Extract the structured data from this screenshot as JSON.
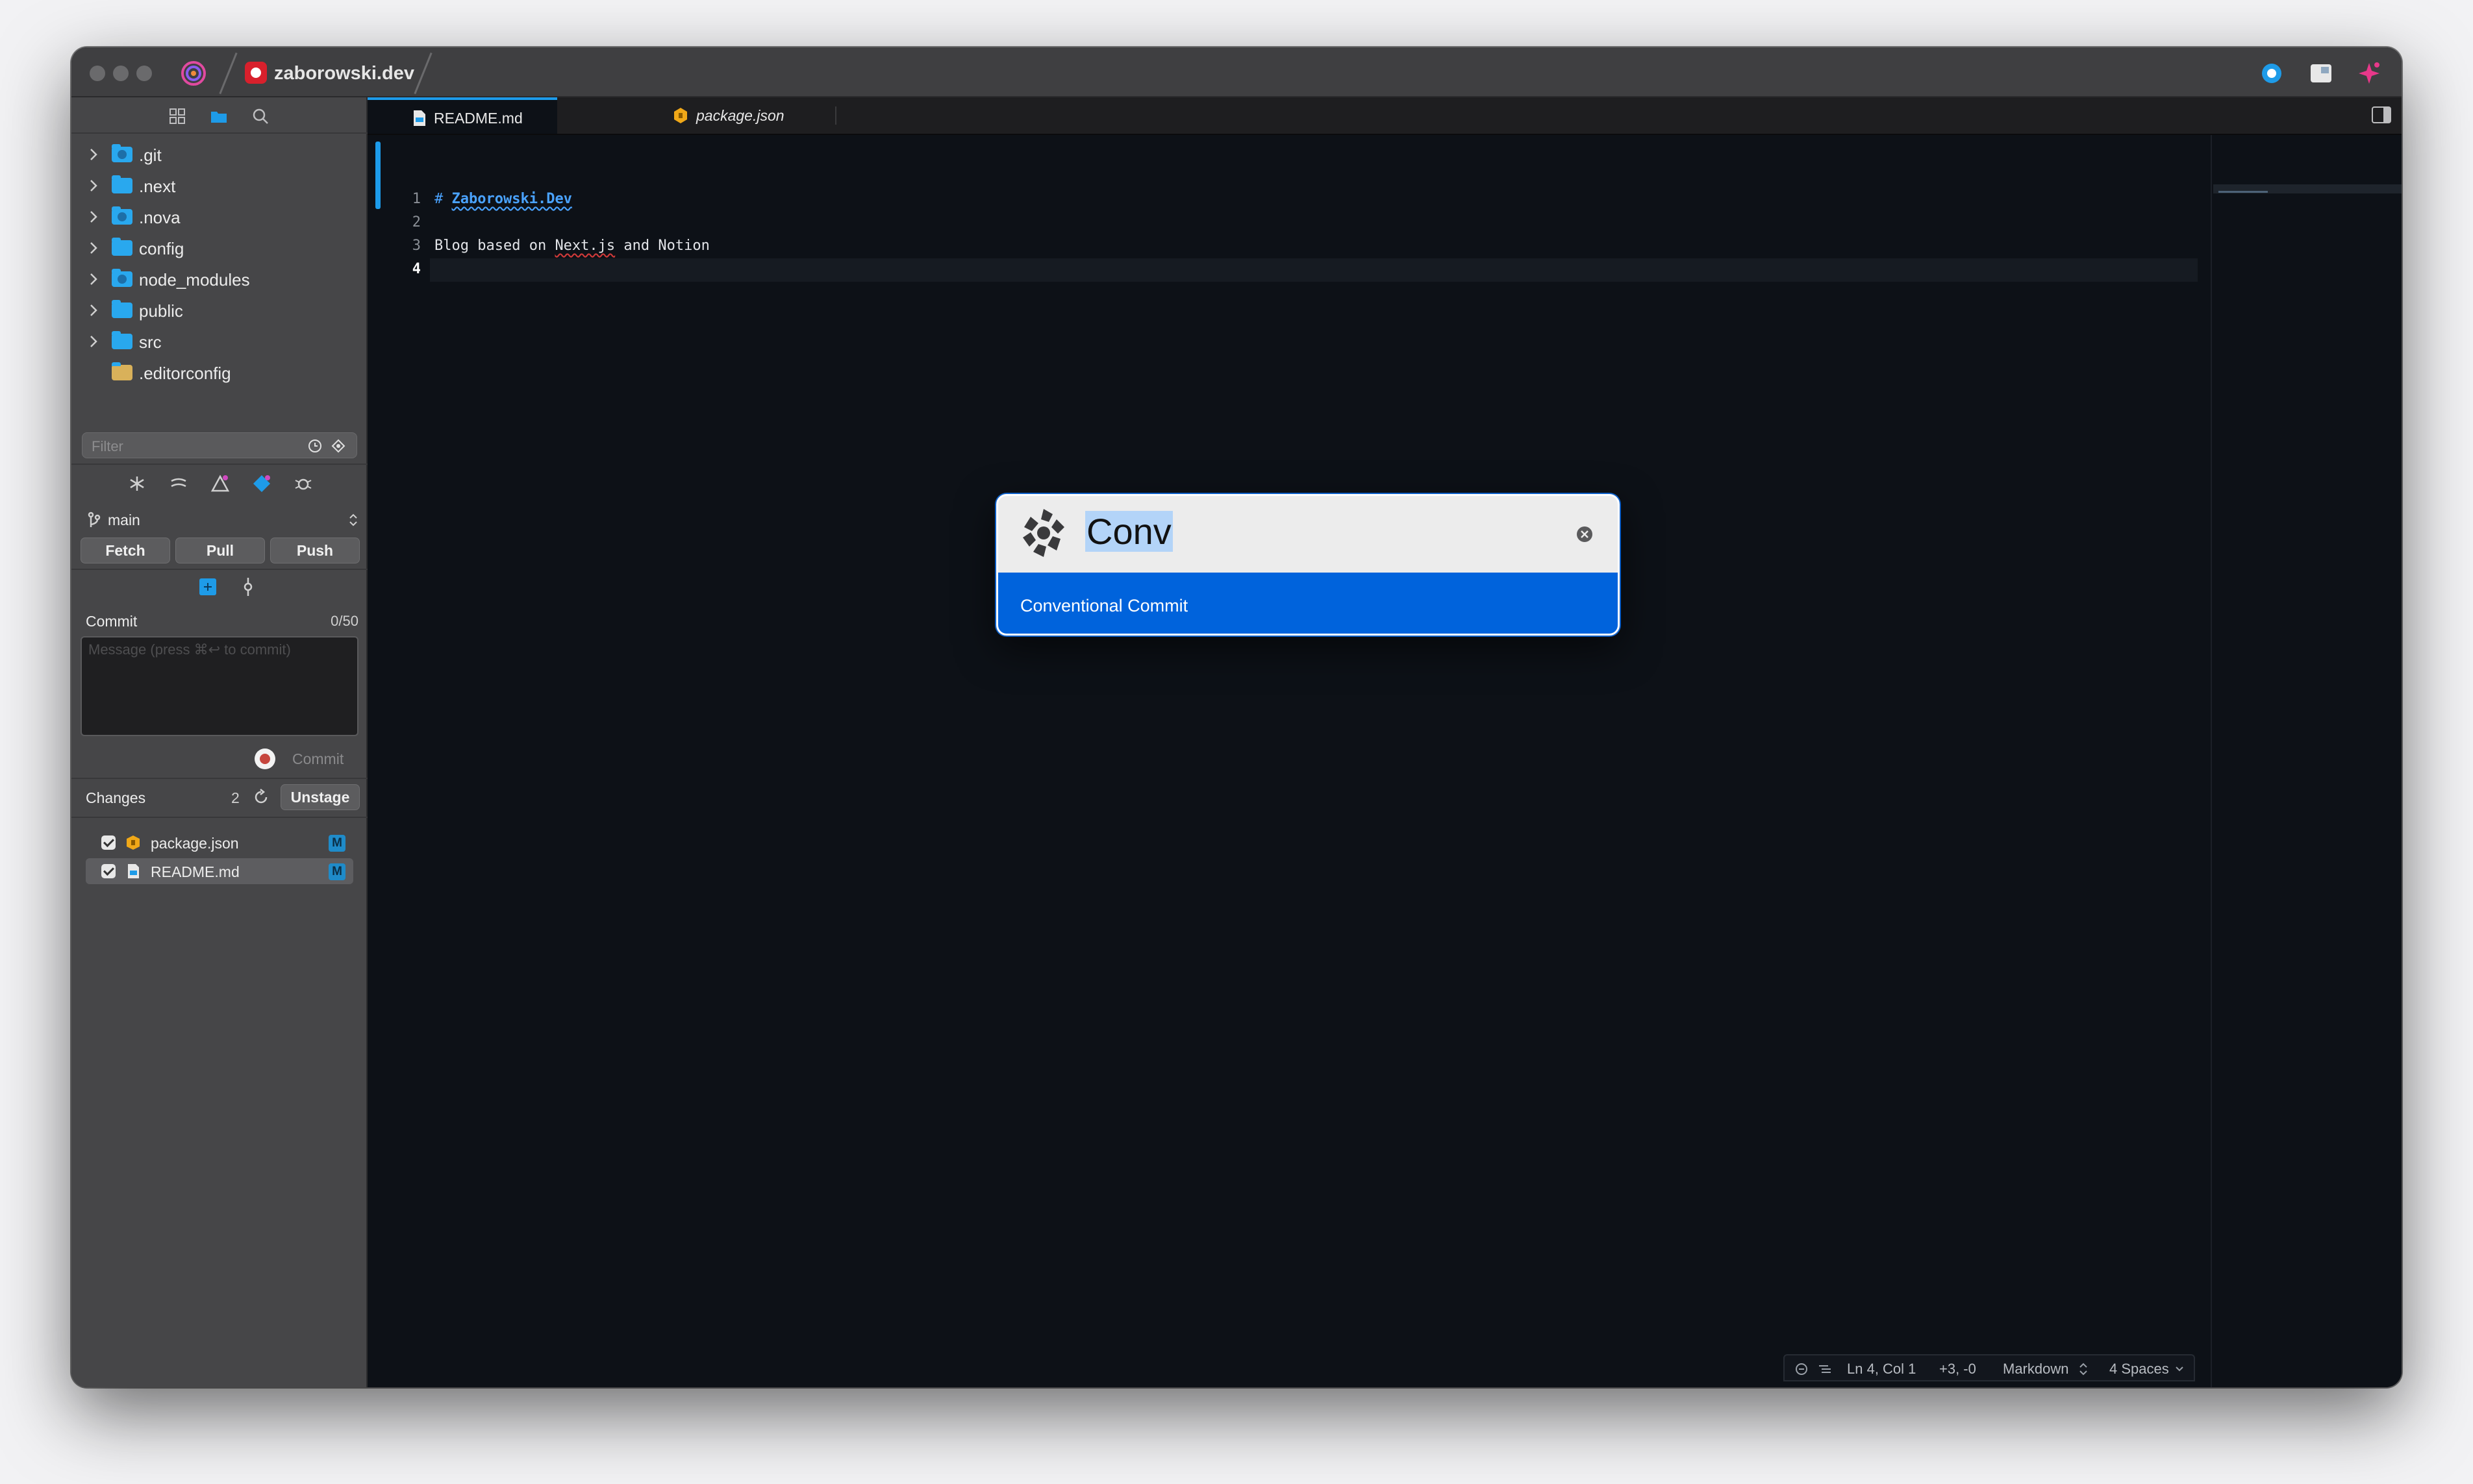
{
  "titlebar": {
    "project_name": "zaborowski.dev",
    "project_color": "#d8202c"
  },
  "sidebar": {
    "tools": [
      "grid-icon",
      "folder-icon",
      "search-icon"
    ],
    "tree": [
      {
        "name": ".git",
        "icon": "git-folder-icon"
      },
      {
        "name": ".next",
        "icon": "folder-icon"
      },
      {
        "name": ".nova",
        "icon": "nova-folder-icon"
      },
      {
        "name": "config",
        "icon": "folder-icon"
      },
      {
        "name": "node_modules",
        "icon": "node-folder-icon"
      },
      {
        "name": "public",
        "icon": "folder-icon"
      },
      {
        "name": "src",
        "icon": "folder-icon"
      },
      {
        "name": ".editorconfig",
        "icon": "file-icon"
      }
    ],
    "filter_placeholder": "Filter",
    "git": {
      "branch": "main",
      "buttons": {
        "fetch": "Fetch",
        "pull": "Pull",
        "push": "Push"
      },
      "commit_label": "Commit",
      "commit_count": "0/50",
      "commit_placeholder": "Message (press ⌘↩ to commit)",
      "commit_button": "Commit",
      "changes_label": "Changes",
      "changes_count": "2",
      "unstage_button": "Unstage",
      "changes": [
        {
          "name": "package.json",
          "status": "M",
          "icon": "npm-package-icon"
        },
        {
          "name": "README.md",
          "status": "M",
          "icon": "markdown-file-icon"
        }
      ]
    }
  },
  "tabs": [
    {
      "label": "README.md",
      "active": true
    },
    {
      "label": "package.json",
      "active": false
    }
  ],
  "editor": {
    "line_numbers": [
      "1",
      "2",
      "3",
      "4"
    ],
    "lines": {
      "l1_hash": "# ",
      "l1_title": "Zaborowski.Dev",
      "l3_a": "Blog based on ",
      "l3_b": "Next.js",
      "l3_c": " and Notion"
    }
  },
  "statusbar": {
    "position": "Ln 4, Col 1",
    "diff": "+3, -0",
    "language": "Markdown",
    "indent": "4 Spaces"
  },
  "palette": {
    "query": "Conv",
    "result": "Conventional Commit",
    "accent": "#0063dc"
  }
}
